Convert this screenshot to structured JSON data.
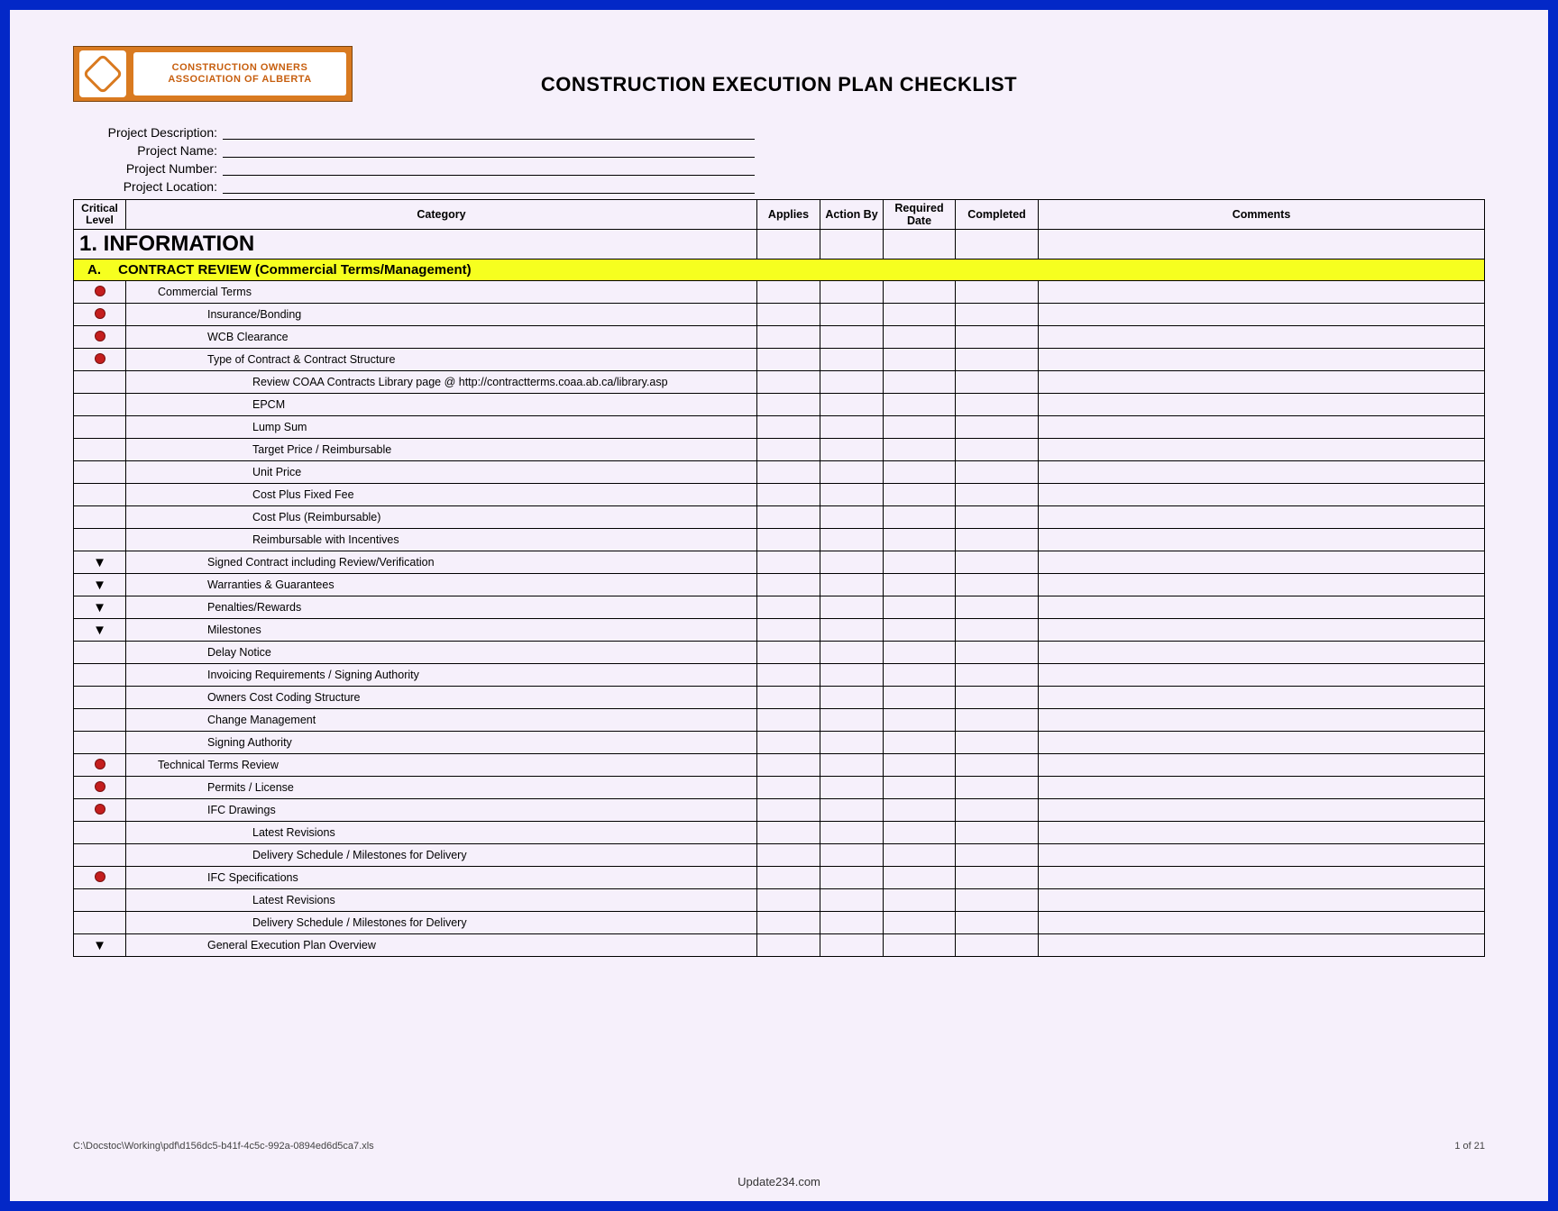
{
  "logo": {
    "line1": "CONSTRUCTION OWNERS",
    "line2": "ASSOCIATION OF ALBERTA"
  },
  "title": "CONSTRUCTION EXECUTION PLAN CHECKLIST",
  "project_info": [
    {
      "label": "Project Description:"
    },
    {
      "label": "Project Name:"
    },
    {
      "label": "Project Number:"
    },
    {
      "label": "Project Location:"
    }
  ],
  "columns": {
    "critical": "Critical Level",
    "category": "Category",
    "applies": "Applies",
    "action": "Action By",
    "required": "Required Date",
    "completed": "Completed",
    "comments": "Comments"
  },
  "section": {
    "number_title": "1. INFORMATION"
  },
  "subsection": {
    "letter": "A.",
    "title": "CONTRACT REVIEW (Commercial Terms/Management)"
  },
  "rows": [
    {
      "mark": "dot",
      "indent": 0,
      "text": "Commercial Terms"
    },
    {
      "mark": "dot",
      "indent": 1,
      "text": "Insurance/Bonding"
    },
    {
      "mark": "dot",
      "indent": 1,
      "text": "WCB Clearance"
    },
    {
      "mark": "dot",
      "indent": 1,
      "text": "Type of Contract & Contract Structure"
    },
    {
      "mark": "",
      "indent": 2,
      "text": "Review COAA Contracts Library page @ http://contractterms.coaa.ab.ca/library.asp"
    },
    {
      "mark": "",
      "indent": 2,
      "text": "EPCM"
    },
    {
      "mark": "",
      "indent": 2,
      "text": "Lump Sum"
    },
    {
      "mark": "",
      "indent": 2,
      "text": "Target Price / Reimbursable"
    },
    {
      "mark": "",
      "indent": 2,
      "text": "Unit Price"
    },
    {
      "mark": "",
      "indent": 2,
      "text": "Cost Plus Fixed Fee"
    },
    {
      "mark": "",
      "indent": 2,
      "text": "Cost Plus (Reimbursable)"
    },
    {
      "mark": "",
      "indent": 2,
      "text": "Reimbursable with Incentives"
    },
    {
      "mark": "arrow",
      "indent": 1,
      "text": "Signed Contract including Review/Verification"
    },
    {
      "mark": "arrow",
      "indent": 1,
      "text": "Warranties & Guarantees"
    },
    {
      "mark": "arrow",
      "indent": 1,
      "text": "Penalties/Rewards"
    },
    {
      "mark": "arrow",
      "indent": 1,
      "text": "Milestones"
    },
    {
      "mark": "",
      "indent": 1,
      "text": "Delay Notice"
    },
    {
      "mark": "",
      "indent": 1,
      "text": "Invoicing Requirements / Signing Authority"
    },
    {
      "mark": "",
      "indent": 1,
      "text": "Owners Cost Coding Structure"
    },
    {
      "mark": "",
      "indent": 1,
      "text": "Change Management"
    },
    {
      "mark": "",
      "indent": 1,
      "text": "Signing Authority"
    },
    {
      "mark": "dot",
      "indent": 0,
      "text": "Technical Terms Review"
    },
    {
      "mark": "dot",
      "indent": 1,
      "text": "Permits / License"
    },
    {
      "mark": "dot",
      "indent": 1,
      "text": "IFC Drawings"
    },
    {
      "mark": "",
      "indent": 2,
      "text": "Latest Revisions"
    },
    {
      "mark": "",
      "indent": 2,
      "text": "Delivery Schedule / Milestones for Delivery"
    },
    {
      "mark": "dot",
      "indent": 1,
      "text": "IFC Specifications"
    },
    {
      "mark": "",
      "indent": 2,
      "text": "Latest Revisions"
    },
    {
      "mark": "",
      "indent": 2,
      "text": "Delivery Schedule / Milestones for Delivery"
    },
    {
      "mark": "arrow",
      "indent": 1,
      "text": "General Execution Plan Overview"
    }
  ],
  "footer": {
    "path": "C:\\Docstoc\\Working\\pdf\\d156dc5-b41f-4c5c-992a-0894ed6d5ca7.xls",
    "page": "1 of 21"
  },
  "site": "Update234.com"
}
